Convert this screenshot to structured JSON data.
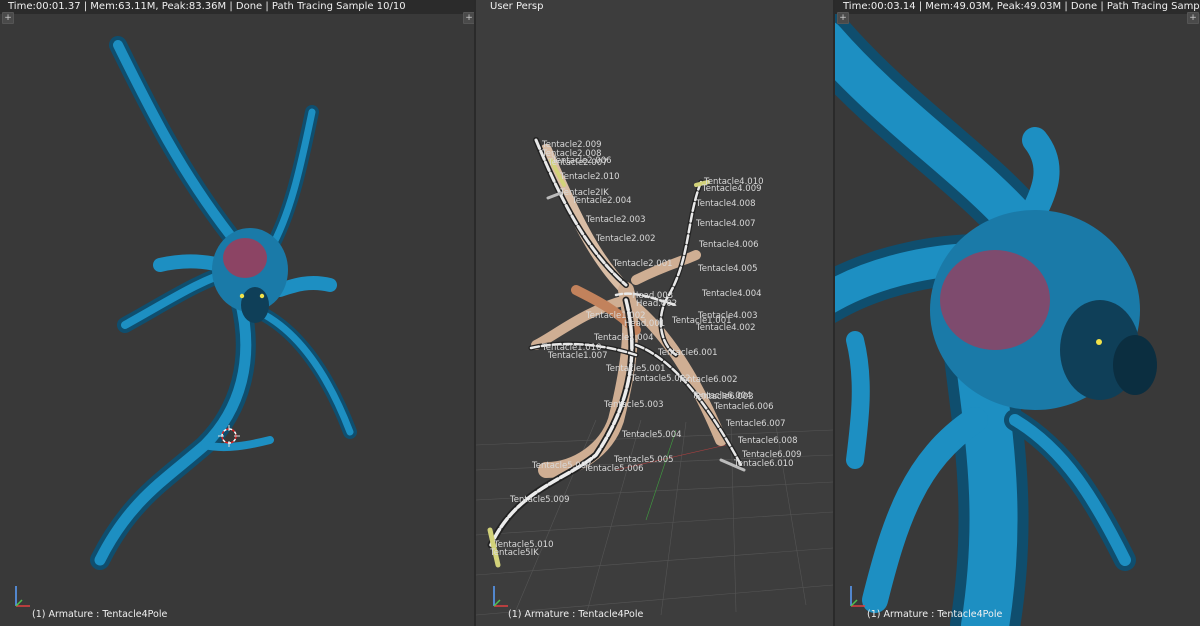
{
  "left_viewport": {
    "header": "Time:00:01.37 | Mem:63.11M, Peak:83.36M | Done | Path Tracing Sample 10/10",
    "footer": "(1) Armature : Tentacle4Pole"
  },
  "center_viewport": {
    "header": "User Persp",
    "footer": "(1) Armature : Tentacle4Pole",
    "bone_labels": [
      "Tentacle2.009",
      "Tentacle2.008",
      "Tentacle2.007",
      "Tentacle2.006",
      "Tentacle2.010",
      "Tentacle2IK",
      "Tentacle2.004",
      "Tentacle2.003",
      "Tentacle2.002",
      "Tentacle2.001",
      "Tentacle4.010",
      "Tentacle4.009",
      "Tentacle4.008",
      "Tentacle4.007",
      "Tentacle4.006",
      "Tentacle4.005",
      "Tentacle4.004",
      "Tentacle4.003",
      "Tentacle4.002",
      "Tentacle1.001",
      "Head.003",
      "Head.002",
      "Tentacle1.002",
      "Head.001",
      "Tentacle1.004",
      "Tentacle6.001",
      "Tentacle6.002",
      "Tentacle6.003",
      "Tentacle6.004",
      "Tentacle5.001",
      "Tentacle5.002",
      "Tentacle5.003",
      "Tentacle6.006",
      "Tentacle6.007",
      "Tentacle5.004",
      "Tentacle6.008",
      "Tentacle6.009",
      "Tentacle6.010",
      "Tentacle5.005",
      "Tentacle5.006",
      "Tentacle5.007",
      "Tentacle5.009",
      "Tentacle5.010",
      "Tentacle5IK",
      "Tentacle1.010",
      "Tentacle1.007"
    ]
  },
  "right_viewport": {
    "header": "Time:00:03.14 | Mem:49.03M, Peak:49.03M | Done | Path Tracing Sample 10/10",
    "footer": "(1) Armature : Tentacle4Pole"
  },
  "colors": {
    "viewport_bg": "#393939",
    "creature_blue": "#1c86b8",
    "creature_dark": "#0e3a52",
    "flesh_red": "#c0304a",
    "skin_tan": "#d7b9a0",
    "bone_yellow": "#d2d27a"
  },
  "icons": {
    "plus": "+",
    "axis": "axis-gizmo-icon",
    "cursor": "3d-cursor-icon"
  }
}
